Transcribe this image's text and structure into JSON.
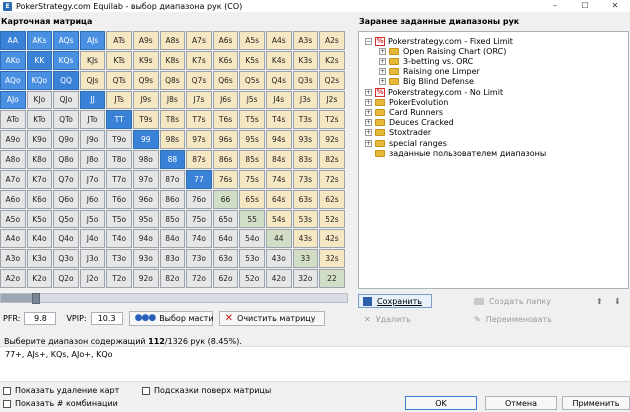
{
  "window": {
    "title": "PokerStrategy.com Equilab - выбор диапазона рук (CO)",
    "app_icon": "E"
  },
  "matrix": {
    "title": "Карточная матрица",
    "rows": [
      [
        "AA",
        "AKs",
        "AQs",
        "AJs",
        "ATs",
        "A9s",
        "A8s",
        "A7s",
        "A6s",
        "A5s",
        "A4s",
        "A3s",
        "A2s"
      ],
      [
        "AKo",
        "KK",
        "KQs",
        "KJs",
        "KTs",
        "K9s",
        "K8s",
        "K7s",
        "K6s",
        "K5s",
        "K4s",
        "K3s",
        "K2s"
      ],
      [
        "AQo",
        "KQo",
        "QQ",
        "QJs",
        "QTs",
        "Q9s",
        "Q8s",
        "Q7s",
        "Q6s",
        "Q5s",
        "Q4s",
        "Q3s",
        "Q2s"
      ],
      [
        "AJo",
        "KJo",
        "QJo",
        "JJ",
        "JTs",
        "J9s",
        "J8s",
        "J7s",
        "J6s",
        "J5s",
        "J4s",
        "J3s",
        "J2s"
      ],
      [
        "ATo",
        "KTo",
        "QTo",
        "JTo",
        "TT",
        "T9s",
        "T8s",
        "T7s",
        "T6s",
        "T5s",
        "T4s",
        "T3s",
        "T2s"
      ],
      [
        "A9o",
        "K9o",
        "Q9o",
        "J9o",
        "T9o",
        "99",
        "98s",
        "97s",
        "96s",
        "95s",
        "94s",
        "93s",
        "92s"
      ],
      [
        "A8o",
        "K8o",
        "Q8o",
        "J8o",
        "T8o",
        "98o",
        "88",
        "87s",
        "86s",
        "85s",
        "84s",
        "83s",
        "82s"
      ],
      [
        "A7o",
        "K7o",
        "Q7o",
        "J7o",
        "T7o",
        "97o",
        "87o",
        "77",
        "76s",
        "75s",
        "74s",
        "73s",
        "72s"
      ],
      [
        "A6o",
        "K6o",
        "Q6o",
        "J6o",
        "T6o",
        "96o",
        "86o",
        "76o",
        "66",
        "65s",
        "64s",
        "63s",
        "62s"
      ],
      [
        "A5o",
        "K5o",
        "Q5o",
        "J5o",
        "T5o",
        "95o",
        "85o",
        "75o",
        "65o",
        "55",
        "54s",
        "53s",
        "52s"
      ],
      [
        "A4o",
        "K4o",
        "Q4o",
        "J4o",
        "T4o",
        "94o",
        "84o",
        "74o",
        "64o",
        "54o",
        "44",
        "43s",
        "42s"
      ],
      [
        "A3o",
        "K3o",
        "Q3o",
        "J3o",
        "T3o",
        "93o",
        "83o",
        "73o",
        "63o",
        "53o",
        "43o",
        "33",
        "32s"
      ],
      [
        "A2o",
        "K2o",
        "Q2o",
        "J2o",
        "T2o",
        "92o",
        "82o",
        "72o",
        "62o",
        "52o",
        "42o",
        "32o",
        "22"
      ]
    ],
    "selected": [
      "AA",
      "AKs",
      "AQs",
      "AJs",
      "AKo",
      "KK",
      "KQs",
      "AQo",
      "KQo",
      "QQ",
      "AJo",
      "JJ",
      "TT",
      "99",
      "88",
      "77"
    ]
  },
  "slider": {
    "value_fraction": 0.1
  },
  "pfr": {
    "label": "PFR:",
    "value": "9.8"
  },
  "vpip": {
    "label": "VPIP:",
    "value": "10.3"
  },
  "buttons": {
    "suits": "Выбор масти",
    "clear": "Очистить матрицу"
  },
  "info": {
    "prefix": "Выберите диапазон содержащий ",
    "count": "112",
    "suffix": "/1326 рук (8.45%)."
  },
  "range_text": "77+, AJs+, KQs, AJo+, KQo",
  "checkboxes": {
    "remove_cards": "Показать удаление карт",
    "hints": "Подсказки поверх матрицы",
    "combos": "Показать # комбинации"
  },
  "tree": {
    "title": "Заранее заданные диапазоны рук",
    "items": [
      {
        "label": "Pokerstrategy.com - Fixed Limit",
        "level": 0,
        "icon": "ps-icon",
        "expander": "−"
      },
      {
        "label": "Open Raising Chart (ORC)",
        "level": 1,
        "icon": "folder-icon",
        "expander": "+"
      },
      {
        "label": "3-betting vs. ORC",
        "level": 1,
        "icon": "folder-icon",
        "expander": "+"
      },
      {
        "label": "Raising one Limper",
        "level": 1,
        "icon": "folder-icon",
        "expander": "+"
      },
      {
        "label": "Big Blind Defense",
        "level": 1,
        "icon": "folder-icon",
        "expander": "+"
      },
      {
        "label": "Pokerstrategy.com - No Limit",
        "level": 0,
        "icon": "ps-icon",
        "expander": "+"
      },
      {
        "label": "PokerEvolution",
        "level": 0,
        "icon": "folder-icon",
        "expander": "+"
      },
      {
        "label": "Card Runners",
        "level": 0,
        "icon": "folder-icon",
        "expander": "+"
      },
      {
        "label": "Deuces Cracked",
        "level": 0,
        "icon": "folder-icon",
        "expander": "+"
      },
      {
        "label": "Stoxtrader",
        "level": 0,
        "icon": "folder-icon",
        "expander": "+"
      },
      {
        "label": "special ranges",
        "level": 0,
        "icon": "folder-icon",
        "expander": "+"
      },
      {
        "label": "заданные пользователем диапазоны",
        "level": 0,
        "icon": "folder-icon",
        "expander": ""
      }
    ]
  },
  "tree_buttons": {
    "save": "Сохранить",
    "new_folder": "Создать папку",
    "delete": "Удалить",
    "rename": "Переименовать"
  },
  "dialog": {
    "ok": "OK",
    "cancel": "Отмена",
    "apply": "Применить"
  }
}
